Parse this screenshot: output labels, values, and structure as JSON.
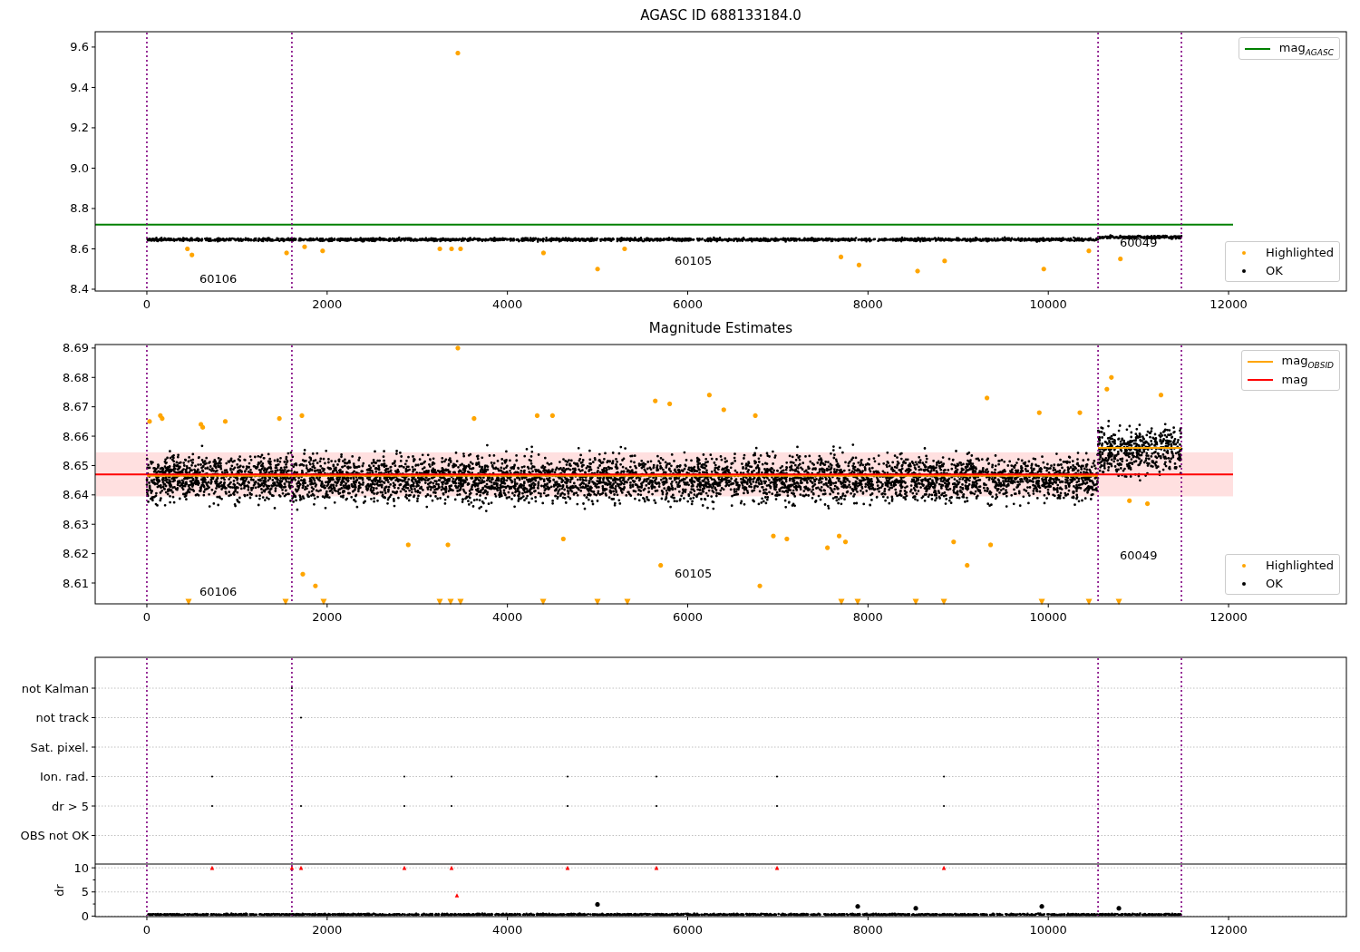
{
  "panels": [
    {
      "chart_data": {
        "type": "scatter",
        "title": "AGASC ID 688133184.0",
        "xlim": [
          -573,
          13307
        ],
        "ylim": [
          8.391,
          9.676
        ],
        "xticks": [
          0,
          2000,
          4000,
          6000,
          8000,
          10000,
          12000
        ],
        "yticks": [
          8.4,
          8.6,
          8.8,
          {
            "value": 9,
            "label": "9.0"
          },
          9.2,
          9.4,
          9.6
        ],
        "series": [
          {
            "name": "mag$_{AGASC}$",
            "type": "line",
            "color": "#008000",
            "x": [
              -573,
              12050
            ],
            "values": [
              8.72,
              8.72
            ]
          },
          {
            "name": "Highlighted",
            "color": "#ffa500",
            "marker": "circle",
            "x": [
              450,
              500,
              1550,
              1750,
              1950,
              3250,
              3380,
              3450,
              3480,
              4400,
              5000,
              5300,
              7700,
              7900,
              8550,
              8850,
              9950,
              10450,
              10800
            ],
            "values": [
              8.6,
              8.57,
              8.58,
              8.61,
              8.59,
              8.6,
              8.6,
              9.57,
              8.6,
              8.58,
              8.5,
              8.6,
              8.56,
              8.52,
              8.49,
              8.54,
              8.5,
              8.59,
              8.55
            ]
          },
          {
            "name": "OK",
            "color": "#000000",
            "marker": "circle"
          }
        ],
        "ref_lines": [
          {
            "axis": "x",
            "value": 0,
            "color": "#800080"
          },
          {
            "axis": "x",
            "value": 1609,
            "color": "#800080"
          },
          {
            "axis": "x",
            "value": 10552,
            "color": "#800080"
          },
          {
            "axis": "x",
            "value": 11477,
            "color": "#800080"
          }
        ],
        "annotations": [
          "60106",
          "60105",
          "60049"
        ]
      }
    },
    {
      "chart_data": {
        "type": "scatter",
        "title": "Magnitude Estimates",
        "xlim": [
          -573,
          13307
        ],
        "ylim": [
          8.6029,
          8.6912
        ],
        "xticks": [
          0,
          2000,
          4000,
          6000,
          8000,
          10000,
          12000
        ],
        "yticks": [
          8.61,
          8.62,
          8.63,
          8.64,
          8.65,
          8.66,
          8.67,
          8.68,
          8.69
        ],
        "series": [
          {
            "name": "mag$_{OBSID}$",
            "type": "line",
            "color": "#ffa500",
            "x": [
              0,
              10552,
              null,
              10552,
              11477
            ],
            "values": [
              8.6465,
              8.6465,
              null,
              8.656,
              8.656
            ]
          },
          {
            "name": "mag",
            "type": "line",
            "color": "#ff0000",
            "x": [
              -573,
              12050
            ],
            "values": [
              8.647,
              8.647
            ]
          },
          {
            "name": "Highlighted",
            "color": "#ffa500",
            "marker": "circle",
            "x": [
              30,
              150,
              170,
              600,
              620,
              870,
              1470,
              1720,
              1730,
              1870,
              2900,
              3340,
              3450,
              3630,
              4330,
              4500,
              4620,
              5640,
              5700,
              5800,
              6240,
              6400,
              6750,
              6800,
              6950,
              7100,
              7550,
              7680,
              7750,
              8950,
              9100,
              9320,
              9360,
              9900,
              10350,
              10650,
              10700,
              10900,
              11100,
              11250
            ],
            "values": [
              8.665,
              8.667,
              8.666,
              8.664,
              8.663,
              8.665,
              8.666,
              8.667,
              8.613,
              8.609,
              8.623,
              8.623,
              8.69,
              8.666,
              8.667,
              8.667,
              8.625,
              8.672,
              8.616,
              8.671,
              8.674,
              8.669,
              8.667,
              8.609,
              8.626,
              8.625,
              8.622,
              8.626,
              8.624,
              8.624,
              8.616,
              8.673,
              8.623,
              8.668,
              8.668,
              8.676,
              8.68,
              8.638,
              8.637,
              8.674
            ]
          },
          {
            "color": "#ffa500",
            "marker": "triangle",
            "x": [
              463,
              1539,
              1961,
              3249,
              3370,
              3480,
              4396,
              4999,
              5331,
              7705,
              7886,
              8530,
              8842,
              9928,
              10451,
              10783
            ],
            "values": [
              8.6035,
              8.6035,
              8.6035,
              8.6035,
              8.6035,
              8.6035,
              8.6035,
              8.6035,
              8.6035,
              8.6035,
              8.6035,
              8.6035,
              8.6035,
              8.6035,
              8.6035,
              8.6035
            ]
          },
          {
            "name": "OK",
            "color": "#000000",
            "marker": "circle"
          }
        ],
        "bands": [
          {
            "axis": "y",
            "from": 8.6395,
            "to": 8.6545,
            "color": "#ff0000"
          }
        ],
        "ref_lines": [
          {
            "axis": "x",
            "value": 0,
            "color": "#800080"
          },
          {
            "axis": "x",
            "value": 1609,
            "color": "#800080"
          },
          {
            "axis": "x",
            "value": 10552,
            "color": "#800080"
          },
          {
            "axis": "x",
            "value": 11477,
            "color": "#800080"
          }
        ],
        "annotations": [
          "60106",
          "60105",
          "60049"
        ]
      }
    },
    {
      "flag_rows": [
        "not Kalman",
        "not track",
        "Sat. pixel.",
        "Ion. rad.",
        "dr > 5",
        "OBS not OK"
      ]
    },
    {
      "chart_data": {
        "type": "scatter",
        "xlim": [
          -573,
          13307
        ],
        "ylim": [
          -0.12,
          10.78
        ],
        "ylabel": "dr",
        "xticks": [
          0,
          2000,
          4000,
          6000,
          8000,
          10000,
          12000
        ],
        "yticks": [
          0,
          5,
          10
        ],
        "series": [
          {
            "color": "#ff0000",
            "marker": "triangle",
            "x": [
              724,
              1609,
              1710,
              2857,
              3380,
              4667,
              5653,
              6991,
              8842,
              3440
            ],
            "values": [
              10,
              10,
              10,
              10,
              10,
              10,
              10,
              10,
              10,
              4.3
            ]
          },
          {
            "color": "#000000",
            "marker": "circle",
            "x": [
              4999,
              7886,
              8530,
              9928,
              10783
            ],
            "values": [
              2.4,
              2.0,
              1.6,
              2.0,
              1.6
            ]
          }
        ],
        "ref_lines": [
          {
            "axis": "x",
            "value": 0,
            "color": "#800080"
          },
          {
            "axis": "x",
            "value": 1609,
            "color": "#800080"
          },
          {
            "axis": "x",
            "value": 10552,
            "color": "#800080"
          },
          {
            "axis": "x",
            "value": 11477,
            "color": "#800080"
          }
        ]
      }
    }
  ]
}
